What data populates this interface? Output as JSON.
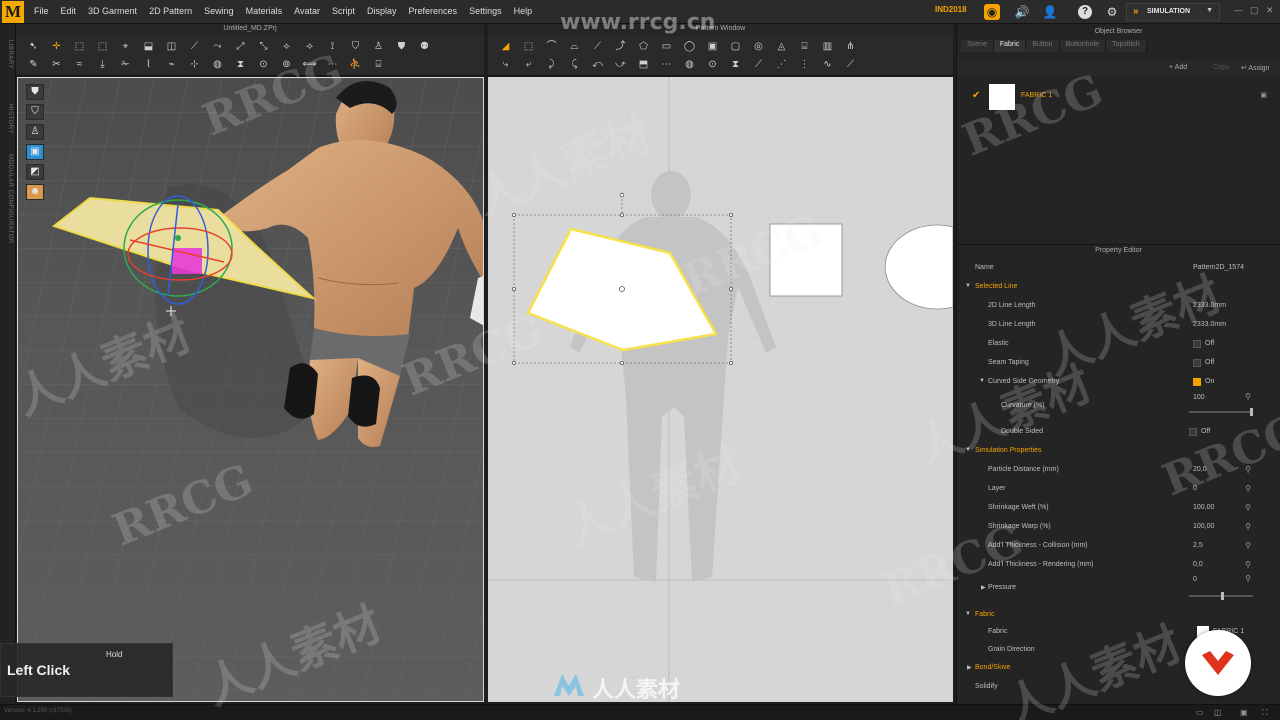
{
  "menubar": {
    "logo": "M",
    "items": [
      "File",
      "Edit",
      "3D Garment",
      "2D Pattern",
      "Sewing",
      "Materials",
      "Avatar",
      "Script",
      "Display",
      "Preferences",
      "Settings",
      "Help"
    ],
    "brand_tag": "IND2018",
    "simulation_label": "SIMULATION"
  },
  "left_strip": [
    "LIBRARY",
    "HISTORY",
    "MODULAR CONFIGURATOR"
  ],
  "view3d": {
    "title": "Untitled_MD.ZPrj",
    "hint_hold": "Hold",
    "hint_action": "Left Click"
  },
  "view2d": {
    "title": "Pattern Window"
  },
  "object_browser": {
    "title": "Object Browser",
    "tabs": [
      "Scene",
      "Fabric",
      "Button",
      "Buttonhole",
      "Topstitch"
    ],
    "active_tab": "Fabric",
    "actions": {
      "add": "+ Add",
      "copy": "Copy",
      "assign": "↵ Assign"
    },
    "fabric_name": "FABRIC 1"
  },
  "property_editor": {
    "title": "Property Editor",
    "name_label": "Name",
    "name_value": "Pattern2D_1574",
    "sections": {
      "selected_line": "Selected Line",
      "simulation": "Simulation Properties",
      "fabric": "Fabric",
      "bond": "Bond/Skive"
    },
    "selected_line": {
      "line2d_label": "2D Line Length",
      "line2d_value": "2333.0mm",
      "line3d_label": "3D Line Length",
      "line3d_value": "2333.0mm",
      "elastic_label": "Elastic",
      "elastic_value": "Off",
      "seam_label": "Seam Taping",
      "seam_value": "Off",
      "curved_label": "Curved Side Geometry",
      "curved_value": "On",
      "curvature_label": "Curvature (%)",
      "curvature_value": "100",
      "double_label": "Double Sided",
      "double_value": "Off"
    },
    "simulation": {
      "particle_label": "Particle Distance (mm)",
      "particle_value": "20,0",
      "layer_label": "Layer",
      "layer_value": "0",
      "weft_label": "Shrinkage Weft (%)",
      "weft_value": "100,00",
      "warp_label": "Shrinkage Warp (%)",
      "warp_value": "100,00",
      "collision_label": "Add'l Thickness - Collision (mm)",
      "collision_value": "2,5",
      "rendering_label": "Add'l Thickness - Rendering (mm)",
      "rendering_value": "0,0",
      "pressure_label": "Pressure",
      "pressure_value": "0"
    },
    "fabric": {
      "fabric_label": "Fabric",
      "fabric_value": "FABRIC 1",
      "grain_label": "Grain Direction"
    },
    "solidify_label": "Solidify"
  },
  "status": {
    "version": "Version: 4.1.250 (r37029)"
  },
  "watermark": {
    "site": "www.rrcg.cn",
    "latin": "RRCG",
    "cn": "人人素材",
    "logo_text": "人人素材"
  },
  "colors": {
    "accent": "#f5a300",
    "selection": "#f6e24a",
    "gizmo_pink": "#e83ad6"
  }
}
